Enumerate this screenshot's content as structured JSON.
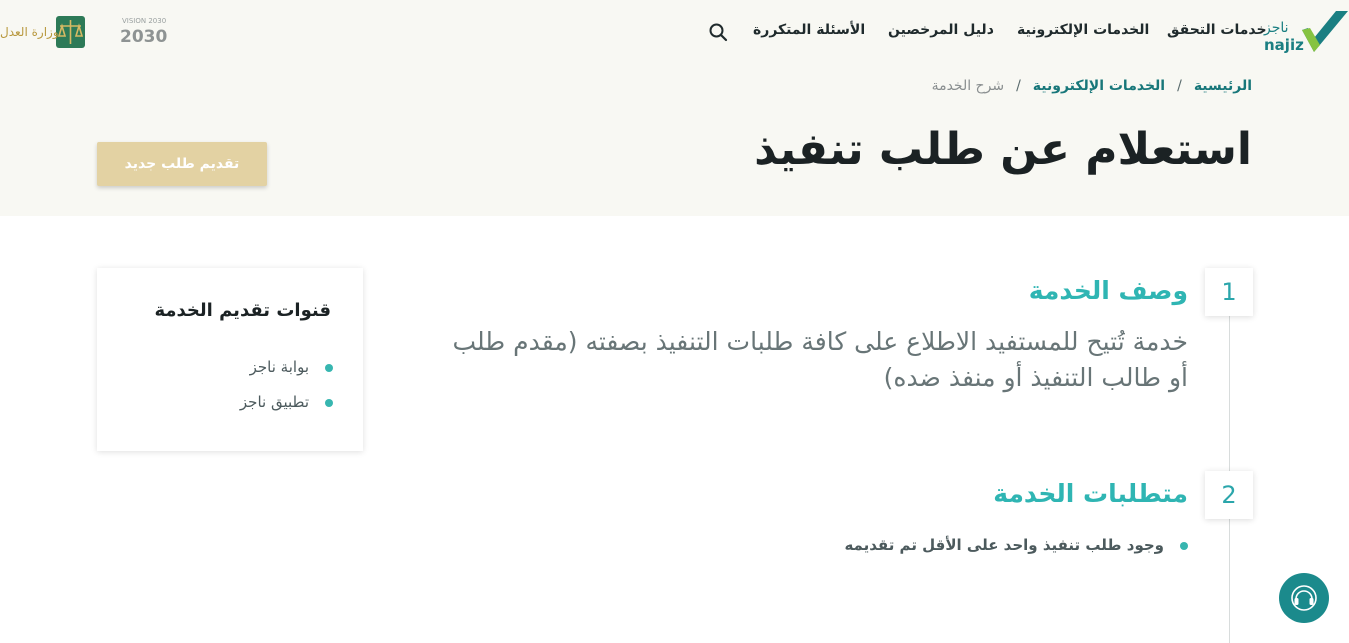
{
  "colors": {
    "top_band": "#f8f8f3",
    "accent_teal": "#2fb5b3",
    "link_teal": "#18777a",
    "button_gold": "#e3d2a3",
    "chat_button": "#1b8a8c"
  },
  "header": {
    "logo_name": "najiz-logo",
    "logo_text_ar": "ناجز",
    "logo_text_en": "najiz",
    "nav": [
      {
        "label": "خدمات التحقق"
      },
      {
        "label": "الخدمات الإلكترونية"
      },
      {
        "label": "دليل المرخصين"
      },
      {
        "label": "الأسئلة المتكررة"
      }
    ],
    "search_icon": "search-icon",
    "vision_logo_text": "VISION 2030",
    "ministry_logo_text": "وزارة العدل"
  },
  "breadcrumb": {
    "items": [
      {
        "label": "الرئيسية"
      },
      {
        "label": "الخدمات الإلكترونية"
      },
      {
        "label": "شرح الخدمة"
      }
    ],
    "separator": "/"
  },
  "page": {
    "title": "استعلام عن طلب تنفيذ",
    "new_request_label": "تقديم طلب جديد"
  },
  "sections": [
    {
      "number": "1",
      "title": "وصف الخدمة",
      "description": "خدمة تُتيح للمستفيد الاطلاع على كافة طلبات التنفيذ بصفته (مقدم طلب أو طالب التنفيذ أو منفذ ضده)"
    },
    {
      "number": "2",
      "title": "متطلبات الخدمة",
      "items": [
        "وجود طلب تنفيذ واحد على الأقل تم تقديمه"
      ]
    }
  ],
  "channels": {
    "title": "قنوات تقديم الخدمة",
    "items": [
      "بوابة ناجز",
      "تطبيق ناجز"
    ]
  },
  "chat": {
    "icon": "support-headset-icon"
  }
}
